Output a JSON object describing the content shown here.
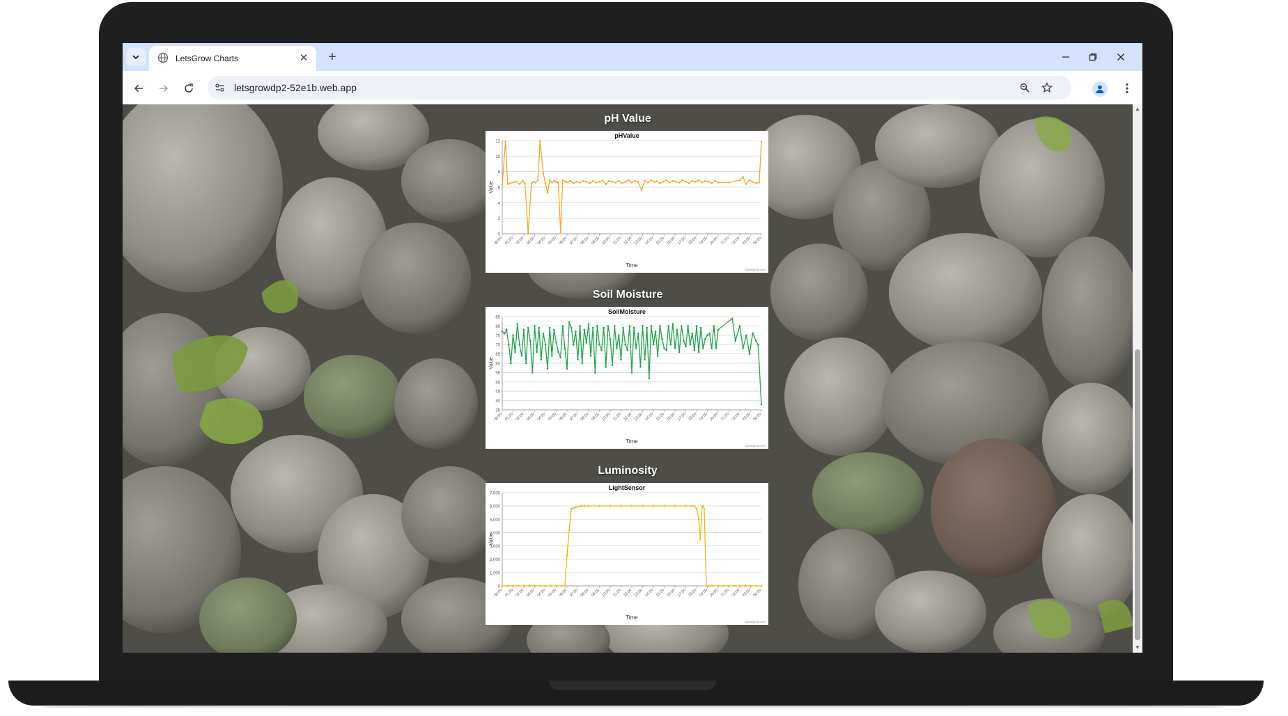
{
  "browser": {
    "tab_title": "LetsGrow Charts",
    "url": "letsgrowdp2-52e1b.web.app"
  },
  "sections": [
    {
      "title": "pH Value"
    },
    {
      "title": "Soil Moisture"
    },
    {
      "title": "Luminosity"
    }
  ],
  "icons": {
    "tab_list": "chevron-down-icon",
    "favicon": "globe-icon",
    "close": "close-icon",
    "new_tab": "plus-icon",
    "back": "arrow-left-icon",
    "forward": "arrow-right-icon",
    "reload": "reload-icon",
    "site_info": "tune-icon",
    "zoom": "zoom-icon",
    "bookmark": "star-icon",
    "profile": "person-icon",
    "menu": "kebab-menu-icon"
  },
  "chart_data": [
    {
      "type": "line",
      "title": "pHValue",
      "xlabel": "Time",
      "ylabel": "Value",
      "ylim": [
        0,
        12
      ],
      "yticks": [
        0,
        2,
        4,
        6,
        8,
        10,
        12
      ],
      "xticks": [
        "00:00",
        "01:00",
        "02:00",
        "03:00",
        "04:00",
        "05:00",
        "06:00",
        "07:00",
        "08:00",
        "09:00",
        "10:00",
        "11:00",
        "12:00",
        "13:00",
        "14:00",
        "15:00",
        "16:00",
        "17:00",
        "18:00",
        "19:00",
        "20:00",
        "21:00",
        "22:00",
        "23:00",
        "00:00"
      ],
      "color": "#f5a623",
      "credit": "CanvasJS.com",
      "x": [
        0,
        0.3,
        0.5,
        0.7,
        1.0,
        1.3,
        1.6,
        1.9,
        2.1,
        2.4,
        2.7,
        2.9,
        3.1,
        3.3,
        3.5,
        3.8,
        4.0,
        4.2,
        4.4,
        4.6,
        4.8,
        5.0,
        5.2,
        5.4,
        5.6,
        5.9,
        6.1,
        6.3,
        6.6,
        6.9,
        7.2,
        7.5,
        7.8,
        8.1,
        8.4,
        8.7,
        9.0,
        9.3,
        9.6,
        9.9,
        10.2,
        10.5,
        10.8,
        11.1,
        11.4,
        11.7,
        12.0,
        12.3,
        12.6,
        12.9,
        13.2,
        13.5,
        13.8,
        14.1,
        14.3,
        14.6,
        14.9,
        15.2,
        15.5,
        15.8,
        16.1,
        16.4,
        16.7,
        17.0,
        17.3,
        17.6,
        17.9,
        18.2,
        18.5,
        18.8,
        19.1,
        19.4,
        19.7,
        20.0,
        21.0,
        22.0,
        22.3,
        22.6,
        22.9,
        23.2,
        23.5,
        23.8,
        24.0
      ],
      "y": [
        6.3,
        11.9,
        6.4,
        6.5,
        6.6,
        6.7,
        6.4,
        6.8,
        6.5,
        0,
        6.5,
        6.7,
        6.6,
        6.9,
        11.9,
        7.8,
        6.5,
        5.3,
        6.9,
        6.6,
        6.8,
        6.7,
        6.6,
        0.2,
        6.9,
        6.7,
        6.6,
        6.8,
        6.5,
        6.7,
        6.6,
        6.8,
        6.7,
        6.5,
        6.8,
        6.6,
        6.7,
        6.9,
        6.4,
        6.8,
        6.7,
        6.6,
        6.8,
        6.5,
        6.7,
        6.9,
        6.6,
        6.8,
        6.7,
        5.6,
        6.8,
        6.6,
        6.9,
        6.7,
        6.8,
        6.5,
        6.7,
        6.9,
        6.6,
        6.8,
        6.7,
        6.6,
        6.9,
        6.7,
        6.5,
        6.8,
        6.7,
        6.9,
        6.6,
        6.8,
        6.7,
        6.5,
        6.8,
        6.6,
        6.6,
        6.9,
        7.3,
        6.4,
        6.9,
        6.7,
        6.5,
        6.6,
        11.9
      ]
    },
    {
      "type": "line",
      "title": "SoilMoisture",
      "xlabel": "Time",
      "ylabel": "Value",
      "ylim": [
        35,
        85
      ],
      "yticks": [
        35,
        40,
        45,
        50,
        55,
        60,
        65,
        70,
        75,
        80,
        85
      ],
      "xticks": [
        "00:00",
        "01:00",
        "02:00",
        "03:00",
        "04:00",
        "05:00",
        "06:00",
        "07:00",
        "08:00",
        "09:00",
        "10:00",
        "11:00",
        "12:00",
        "13:00",
        "14:00",
        "15:00",
        "16:00",
        "17:00",
        "18:00",
        "19:00",
        "20:00",
        "21:00",
        "22:00",
        "23:00",
        "00:00"
      ],
      "color": "#1fa34a",
      "credit": "CanvasJS.com",
      "x": [
        0,
        0.2,
        0.4,
        0.6,
        0.8,
        1.0,
        1.2,
        1.4,
        1.6,
        1.8,
        2.0,
        2.2,
        2.4,
        2.6,
        2.8,
        3.0,
        3.2,
        3.4,
        3.6,
        3.8,
        4.0,
        4.2,
        4.4,
        4.6,
        4.8,
        5.0,
        5.2,
        5.4,
        5.6,
        5.8,
        6.0,
        6.2,
        6.4,
        6.6,
        6.8,
        7.0,
        7.2,
        7.4,
        7.6,
        7.8,
        8.0,
        8.2,
        8.4,
        8.6,
        8.8,
        9.0,
        9.2,
        9.4,
        9.6,
        9.8,
        10.0,
        10.2,
        10.4,
        10.6,
        10.8,
        11.0,
        11.2,
        11.4,
        11.6,
        11.8,
        12.0,
        12.2,
        12.4,
        12.6,
        12.8,
        13.0,
        13.2,
        13.4,
        13.6,
        13.8,
        14.0,
        14.2,
        14.4,
        14.6,
        14.8,
        15.0,
        15.2,
        15.4,
        15.6,
        15.8,
        16.0,
        16.2,
        16.4,
        16.6,
        16.8,
        17.0,
        17.2,
        17.4,
        17.6,
        17.8,
        18.0,
        18.2,
        18.4,
        18.6,
        18.8,
        19.0,
        19.2,
        19.4,
        19.6,
        19.8,
        20.0,
        21.3,
        21.6,
        22.0,
        22.3,
        22.6,
        22.9,
        23.2,
        23.5,
        23.7,
        24.0
      ],
      "y": [
        77,
        76,
        78,
        70,
        60,
        75,
        66,
        81,
        70,
        64,
        78,
        60,
        79,
        72,
        55,
        80,
        66,
        79,
        62,
        76,
        70,
        57,
        79,
        64,
        78,
        71,
        66,
        63,
        80,
        68,
        57,
        82,
        79,
        70,
        77,
        62,
        80,
        60,
        78,
        71,
        81,
        64,
        79,
        55,
        80,
        70,
        67,
        79,
        58,
        80,
        73,
        59,
        80,
        68,
        75,
        62,
        79,
        70,
        67,
        80,
        55,
        79,
        68,
        76,
        58,
        80,
        62,
        79,
        52,
        80,
        70,
        77,
        64,
        80,
        73,
        68,
        67,
        80,
        70,
        81,
        68,
        78,
        66,
        80,
        72,
        69,
        80,
        70,
        76,
        67,
        80,
        66,
        79,
        68,
        73,
        75,
        76,
        68,
        80,
        68,
        78,
        84,
        72,
        80,
        68,
        75,
        65,
        76,
        72,
        70,
        38
      ]
    },
    {
      "type": "line",
      "title": "LightSensor",
      "xlabel": "Time",
      "ylabel": "Value",
      "ylim": [
        0,
        7000
      ],
      "yticks": [
        0,
        1000,
        2000,
        3000,
        4000,
        5000,
        6000,
        7000
      ],
      "ytick_labels": [
        "0",
        "1,000",
        "2,000",
        "3,000",
        "4,000",
        "5,000",
        "6,000",
        "7,000"
      ],
      "xticks": [
        "00:00",
        "01:00",
        "02:00",
        "03:00",
        "04:00",
        "05:00",
        "06:00",
        "07:00",
        "08:00",
        "09:00",
        "10:00",
        "11:00",
        "12:00",
        "13:00",
        "14:00",
        "15:00",
        "16:00",
        "17:00",
        "18:00",
        "19:00",
        "20:00",
        "21:00",
        "22:00",
        "23:00",
        "00:00"
      ],
      "color": "#f2b705",
      "credit": "CanvasJS.com",
      "x": [
        0,
        0.5,
        1,
        1.5,
        2,
        2.5,
        3,
        3.5,
        4,
        4.5,
        5,
        5.5,
        5.8,
        6.0,
        6.2,
        6.4,
        6.6,
        6.8,
        7.0,
        7.3,
        7.6,
        8,
        9,
        10,
        11,
        12,
        13,
        14,
        15,
        16,
        17,
        17.5,
        17.8,
        18.0,
        18.2,
        18.35,
        18.5,
        18.6,
        18.7,
        18.9,
        19.1,
        19.3,
        19.5,
        20,
        20.5,
        21,
        21.5,
        22,
        22.5,
        23,
        23.5,
        24
      ],
      "y": [
        0,
        0,
        0,
        0,
        0,
        0,
        0,
        0,
        0,
        0,
        0,
        0,
        0,
        2300,
        4200,
        5800,
        5850,
        5900,
        5950,
        6000,
        6000,
        6000,
        6000,
        6000,
        6000,
        6000,
        6000,
        6000,
        6000,
        6000,
        6000,
        6000,
        6000,
        5800,
        5000,
        3500,
        5900,
        6000,
        5800,
        0,
        0,
        0,
        0,
        0,
        0,
        0,
        0,
        0,
        0,
        0,
        0,
        0
      ]
    }
  ]
}
